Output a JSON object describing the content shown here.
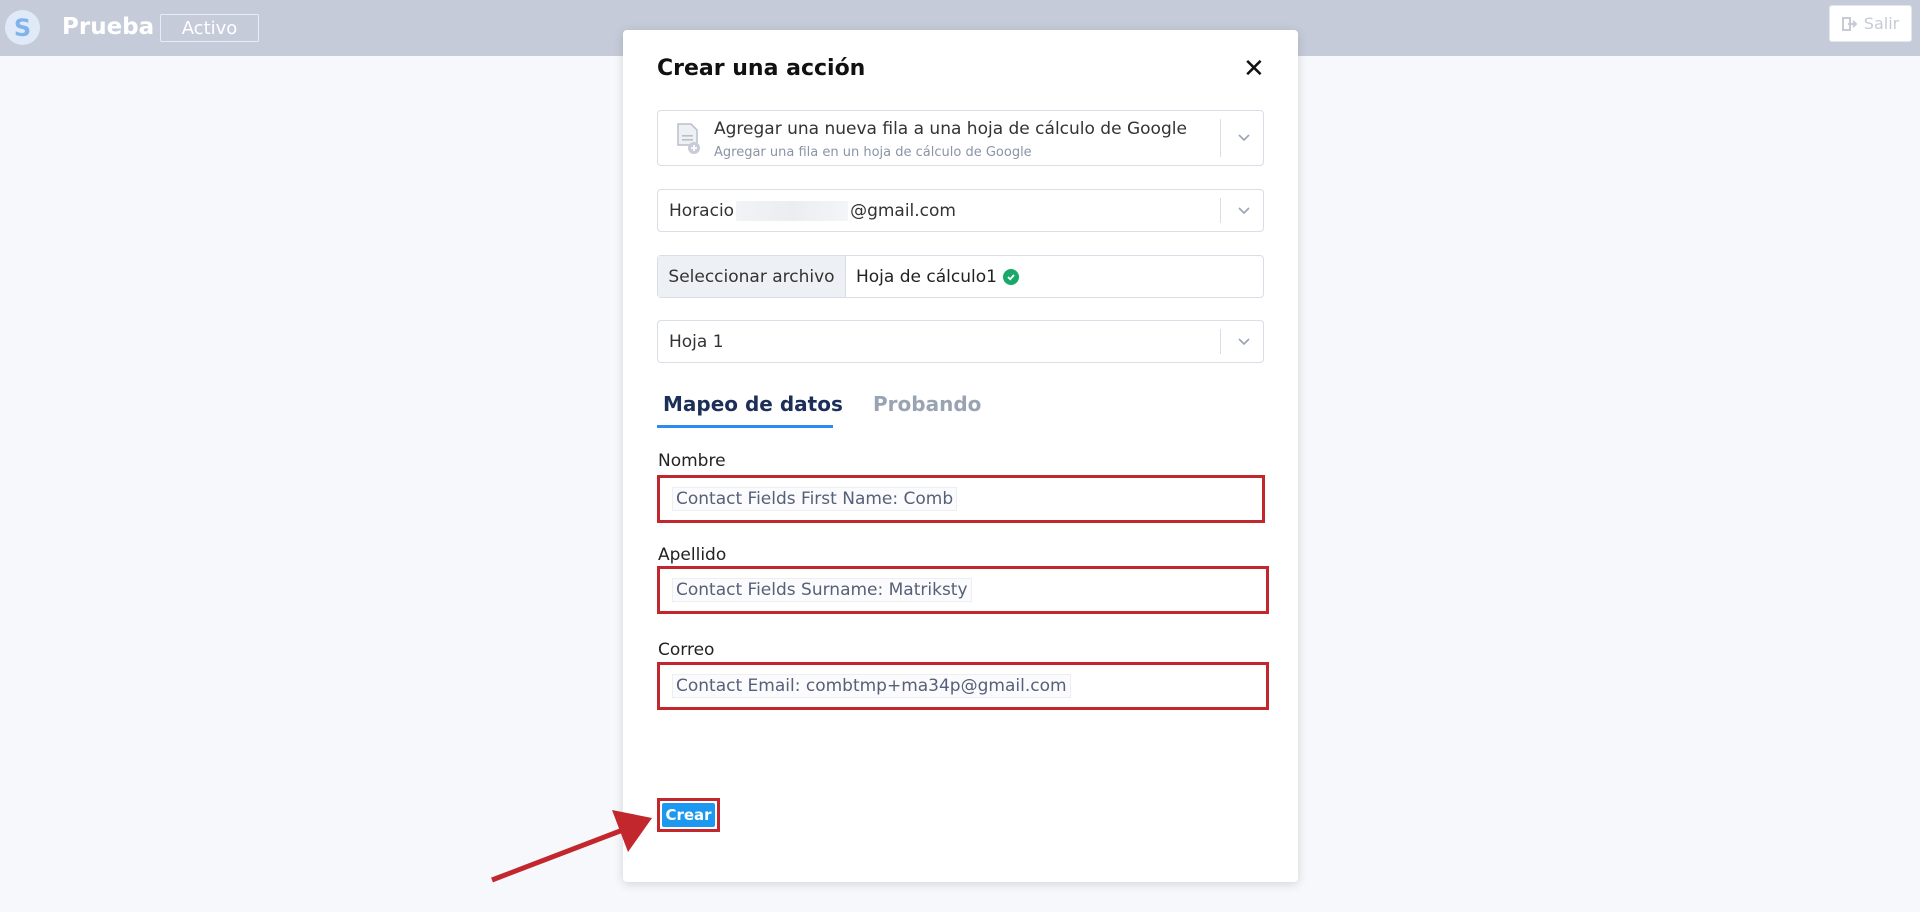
{
  "header": {
    "logo_letter": "S",
    "app_name": "Prueba",
    "status": "Activo",
    "logout_label": "Salir"
  },
  "modal": {
    "title": "Crear una acción",
    "action": {
      "title": "Agregar una nueva fila a una hoja de cálculo de Google",
      "subtitle": "Agregar una fila en un hoja de cálculo de Google"
    },
    "account": {
      "prefix": "Horacio",
      "suffix": "@gmail.com"
    },
    "file": {
      "button_label": "Seleccionar archivo",
      "selected": "Hoja de cálculo1"
    },
    "sheet": "Hoja 1",
    "tabs": [
      {
        "label": "Mapeo de datos",
        "active": true
      },
      {
        "label": "Probando",
        "active": false
      }
    ],
    "fields": [
      {
        "label": "Nombre",
        "value": "Contact Fields First Name: Comb"
      },
      {
        "label": "Apellido",
        "value": "Contact Fields Surname: Matriksty"
      },
      {
        "label": "Correo",
        "value": "Contact Email: combtmp+ma34p@gmail.com"
      }
    ],
    "create_label": "Crear"
  },
  "colors": {
    "topbar": "#c5cbd8",
    "highlight": "#c1272d",
    "accent": "#1d98f0",
    "tab_active": "#1c2f58"
  }
}
